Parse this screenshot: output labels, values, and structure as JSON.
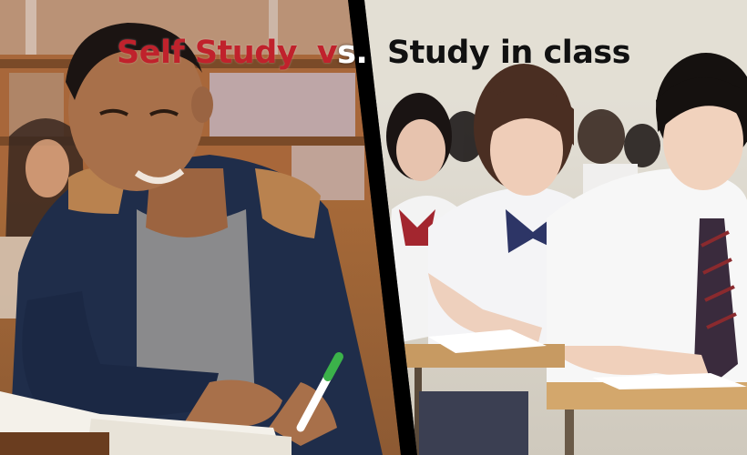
{
  "title": {
    "part1": "Self Study",
    "vs_v": "v",
    "vs_s": "s.",
    "part2": "Study in class"
  },
  "colors": {
    "accent_red": "#c0222c",
    "dark_text": "#111111",
    "divider": "#000000"
  }
}
